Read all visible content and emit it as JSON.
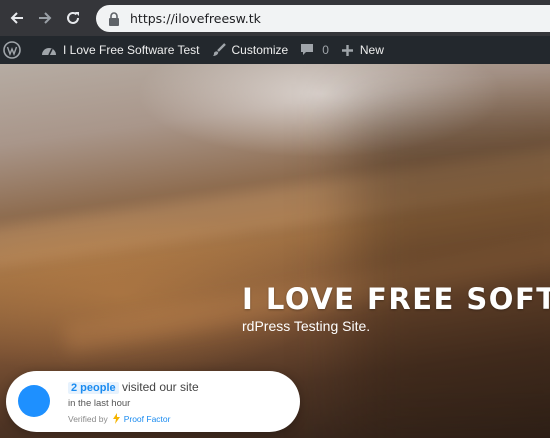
{
  "browser": {
    "url": "https://ilovefreesw.tk",
    "icons": [
      "back-arrow-icon",
      "forward-arrow-icon",
      "reload-icon",
      "lock-icon"
    ]
  },
  "adminbar": {
    "site_name": "I Love Free Software Test",
    "customize": "Customize",
    "comments_count": "0",
    "new_label": "New"
  },
  "hero": {
    "title": "I LOVE FREE SOFT",
    "tagline": "rdPress Testing Site."
  },
  "notification": {
    "people": "2 people",
    "visited": "visited our site",
    "timeframe": "in the last hour",
    "verified_by": "Verified by",
    "brand": "Proof Factor",
    "accent_color": "#1a8bf0"
  }
}
